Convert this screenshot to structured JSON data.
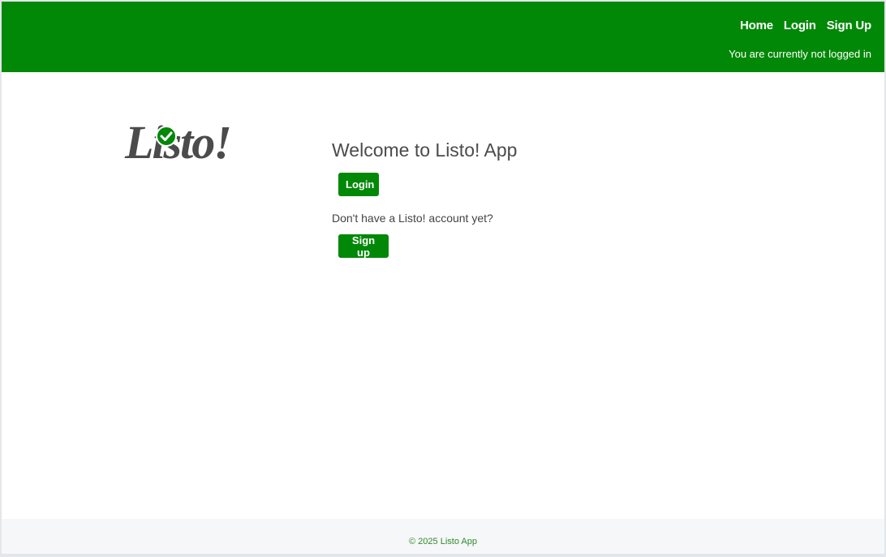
{
  "header": {
    "nav": {
      "home": "Home",
      "login": "Login",
      "signup": "Sign Up"
    },
    "status": "You are currently not logged in"
  },
  "logo": {
    "text": "Listo!",
    "icon": "check-circle-icon"
  },
  "main": {
    "welcome": "Welcome to Listo! App",
    "login_button": "Login",
    "signup_prompt": "Don't have a Listo! account yet?",
    "signup_button": "Sign up"
  },
  "footer": {
    "copyright": "© 2025 Listo App"
  },
  "colors": {
    "brand": "#028807",
    "logo_text": "#4b4b4b",
    "footer_text": "#2e8b2a"
  }
}
